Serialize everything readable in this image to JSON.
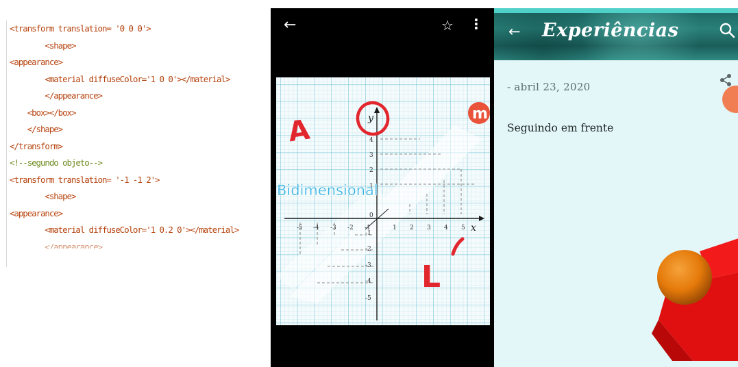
{
  "code_editor": {
    "lines": [
      "<transform translation= '0 0 0'>",
      "        <shape>",
      "<appearance>",
      "        <material diffuseColor='1 0 0'></material>",
      "        </appearance>",
      "    <box></box>",
      "    </shape>",
      "</transform>",
      "<!--segundo objeto-->",
      "<transform translation= '-1 -1 2'>",
      "        <shape>",
      "<appearance>",
      "        <material diffuseColor='1 0.2 0'></material>",
      "        </appearance>"
    ]
  },
  "photo_viewer": {
    "icons": [
      "back-arrow-icon",
      "star-icon",
      "more-vert-icon"
    ],
    "back_glyph": "←",
    "star_glyph": "☆",
    "more_glyph": "⋮",
    "photo": {
      "handwritten_a": "A",
      "handwritten_l": "L",
      "overlay_text": "Bidimensional",
      "axis_x_label": "x",
      "axis_y_label": "y",
      "x_ticks": [
        "-5",
        "-4",
        "-3",
        "-2",
        "-1",
        "1",
        "2",
        "3",
        "4",
        "5"
      ],
      "y_ticks": [
        "4",
        "3",
        "2",
        "1",
        "-1",
        "-2",
        "-3",
        "-4",
        "-5"
      ],
      "origin_label": "0",
      "logo_letter": "m"
    }
  },
  "blog": {
    "back_glyph": "←",
    "title": "Experiências",
    "date": "- abril 23, 2020",
    "post_title": "Seguindo em frente",
    "icons": [
      "back-arrow-icon",
      "search-icon",
      "share-icon"
    ],
    "colors": {
      "accent": "#4fd0c8",
      "background": "#e3f6f8",
      "sphere": "#e97b0e",
      "box": "#e01010"
    }
  }
}
